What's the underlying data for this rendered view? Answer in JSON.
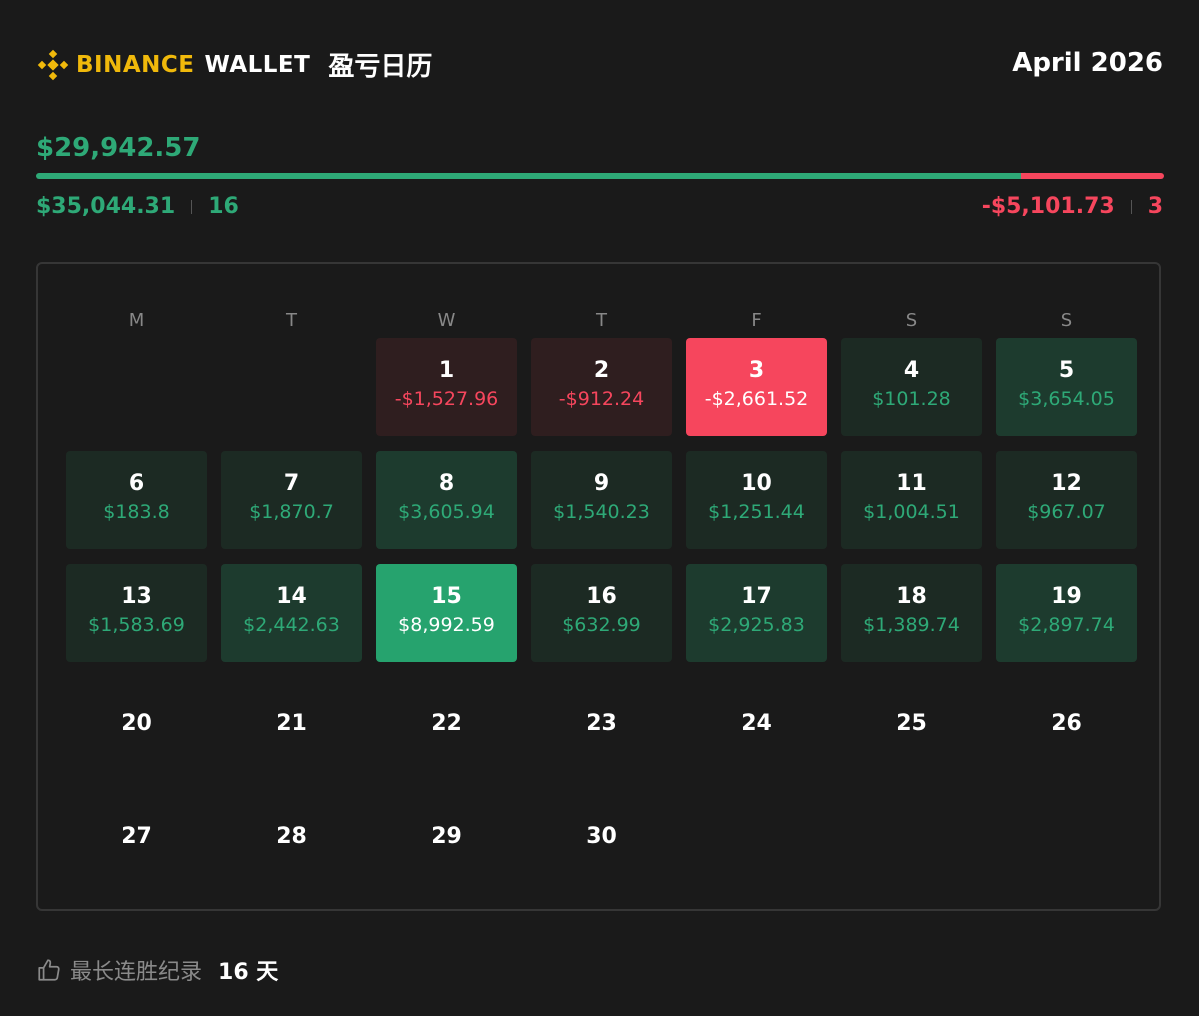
{
  "header": {
    "brand_primary": "BINANCE",
    "brand_secondary": "WALLET",
    "title": "盈亏日历",
    "month": "April 2026"
  },
  "summary": {
    "total": "$29,942.57",
    "gain_fraction": 0.873,
    "gain_total": "$35,044.31",
    "gain_days": "16",
    "loss_total": "-$5,101.73",
    "loss_days": "3"
  },
  "weekdays": [
    "M",
    "T",
    "W",
    "T",
    "F",
    "S",
    "S"
  ],
  "days": [
    {
      "day": "1",
      "pnl": "-$1,527.96",
      "level": "r1"
    },
    {
      "day": "2",
      "pnl": "-$912.24",
      "level": "r1"
    },
    {
      "day": "3",
      "pnl": "-$2,661.52",
      "level": "r3"
    },
    {
      "day": "4",
      "pnl": "$101.28",
      "level": "g1"
    },
    {
      "day": "5",
      "pnl": "$3,654.05",
      "level": "g2"
    },
    {
      "day": "6",
      "pnl": "$183.8",
      "level": "g1"
    },
    {
      "day": "7",
      "pnl": "$1,870.7",
      "level": "g1"
    },
    {
      "day": "8",
      "pnl": "$3,605.94",
      "level": "g2"
    },
    {
      "day": "9",
      "pnl": "$1,540.23",
      "level": "g1"
    },
    {
      "day": "10",
      "pnl": "$1,251.44",
      "level": "g1"
    },
    {
      "day": "11",
      "pnl": "$1,004.51",
      "level": "g1"
    },
    {
      "day": "12",
      "pnl": "$967.07",
      "level": "g1"
    },
    {
      "day": "13",
      "pnl": "$1,583.69",
      "level": "g1"
    },
    {
      "day": "14",
      "pnl": "$2,442.63",
      "level": "g2"
    },
    {
      "day": "15",
      "pnl": "$8,992.59",
      "level": "g3"
    },
    {
      "day": "16",
      "pnl": "$632.99",
      "level": "g1"
    },
    {
      "day": "17",
      "pnl": "$2,925.83",
      "level": "g2"
    },
    {
      "day": "18",
      "pnl": "$1,389.74",
      "level": "g1"
    },
    {
      "day": "19",
      "pnl": "$2,897.74",
      "level": "g2"
    },
    {
      "day": "20"
    },
    {
      "day": "21"
    },
    {
      "day": "22"
    },
    {
      "day": "23"
    },
    {
      "day": "24"
    },
    {
      "day": "25"
    },
    {
      "day": "26"
    },
    {
      "day": "27"
    },
    {
      "day": "28"
    },
    {
      "day": "29"
    },
    {
      "day": "30"
    }
  ],
  "footer": {
    "icon": "thumbs-up-icon",
    "streak_label": "最长连胜纪录",
    "streak_value": "16 天"
  },
  "colors": {
    "gain": "#2ea977",
    "loss": "#f6465d",
    "brand": "#f0b90b"
  }
}
